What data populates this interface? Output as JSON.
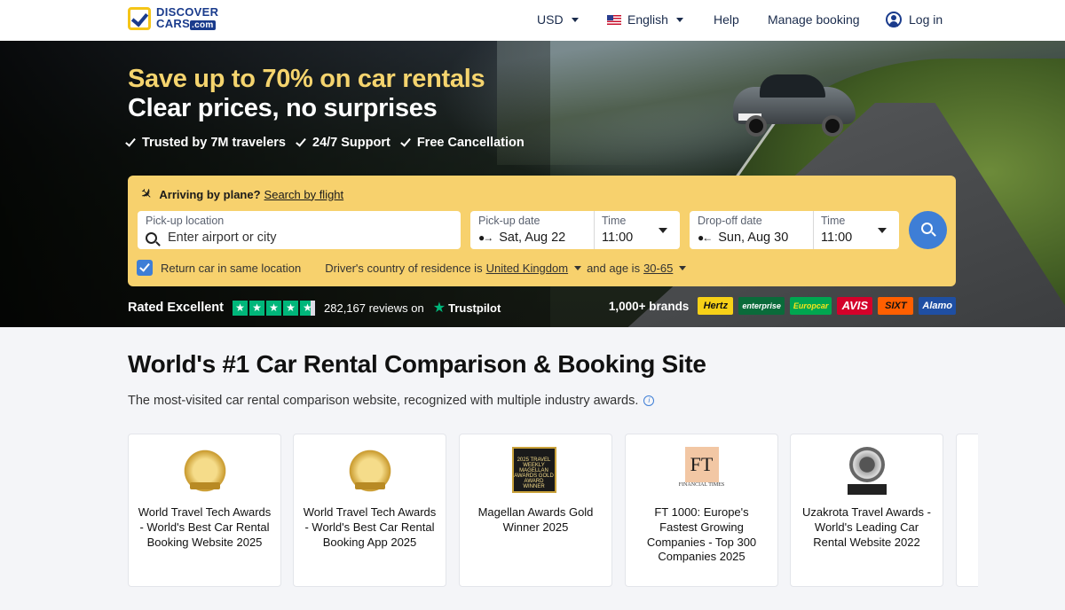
{
  "header": {
    "logo_line1": "DISCOVER",
    "logo_line2": "CARS",
    "logo_suffix": ".com",
    "currency": "USD",
    "language": "English",
    "help": "Help",
    "manage_booking": "Manage booking",
    "login": "Log in"
  },
  "hero": {
    "headline_highlight": "Save up to 70% on car rentals",
    "headline_main": "Clear prices, no surprises",
    "perks": [
      "Trusted by 7M travelers",
      "24/7 Support",
      "Free Cancellation"
    ]
  },
  "search": {
    "arriving_label": "Arriving by plane?",
    "arriving_link": "Search by flight",
    "pickup_location_label": "Pick-up location",
    "pickup_location_placeholder": "Enter airport or city",
    "pickup_date_label": "Pick-up date",
    "pickup_date_value": "Sat, Aug 22",
    "pickup_time_label": "Time",
    "pickup_time_value": "11:00",
    "dropoff_date_label": "Drop-off date",
    "dropoff_date_value": "Sun, Aug 30",
    "dropoff_time_label": "Time",
    "dropoff_time_value": "11:00",
    "return_same_label": "Return car in same location",
    "return_same_checked": true,
    "residence_prefix": "Driver's country of residence is",
    "residence_value": "United Kingdom",
    "age_prefix": "and age is",
    "age_value": "30-65"
  },
  "rating": {
    "label": "Rated Excellent",
    "star_count": 5,
    "reviews": "282,167 reviews on",
    "provider": "Trustpilot"
  },
  "brands": {
    "label": "1,000+ brands",
    "items": [
      {
        "name": "Hertz",
        "bg": "#f7d117",
        "fg": "#111111"
      },
      {
        "name": "enterprise",
        "bg": "#0a6b3a",
        "fg": "#ffffff"
      },
      {
        "name": "Europcar",
        "bg": "#00a650",
        "fg": "#f7e51a"
      },
      {
        "name": "AVIS",
        "bg": "#d4002a",
        "fg": "#ffffff"
      },
      {
        "name": "SIXT",
        "bg": "#ff5f00",
        "fg": "#111111"
      },
      {
        "name": "Alamo",
        "bg": "#1f4fa3",
        "fg": "#ffffff"
      }
    ]
  },
  "awards": {
    "title": "World's #1 Car Rental Comparison & Booking Site",
    "subtitle": "The most-visited car rental comparison website, recognized with multiple industry awards.",
    "cards": [
      {
        "icon": "world-travel-tech-laurel-icon",
        "text": "World Travel Tech Awards - World's Best Car Rental Booking Website 2025"
      },
      {
        "icon": "world-travel-tech-laurel-icon",
        "text": "World Travel Tech Awards - World's Best Car Rental Booking App 2025"
      },
      {
        "icon": "magellan-award-icon",
        "badge": "2025 TRAVEL WEEKLY MAGELLAN AWARDS GOLD AWARD WINNER",
        "text": "Magellan Awards Gold Winner 2025"
      },
      {
        "icon": "financial-times-icon",
        "badge": "FT",
        "badge_sub": "FINANCIAL TIMES",
        "text": "FT 1000: Europe's Fastest Growing Companies - Top 300 Companies 2025"
      },
      {
        "icon": "uzakrota-award-icon",
        "text": "Uzakrota Travel Awards - World's Leading Car Rental Website 2022"
      }
    ]
  },
  "colors": {
    "accent_yellow": "#f7d16d",
    "headline_yellow": "#f5d46e",
    "primary_blue": "#3e7ed6",
    "trustpilot_green": "#00b67a",
    "navy": "#1a3b8c"
  }
}
